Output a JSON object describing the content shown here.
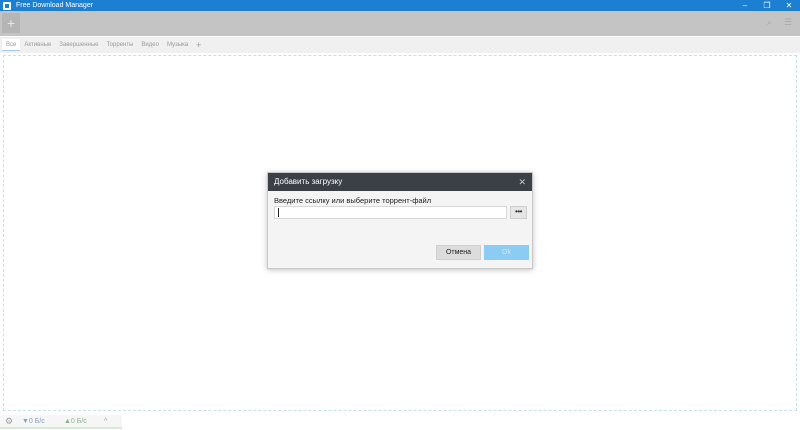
{
  "window": {
    "title": "Free Download Manager",
    "minimize_icon": "minimize-icon",
    "restore_icon": "restore-icon",
    "close_icon": "close-icon"
  },
  "toolbar": {
    "add_label": "+",
    "search_icon": "search-icon",
    "menu_icon": "menu-icon"
  },
  "tabs": [
    {
      "label": "Все",
      "active": true
    },
    {
      "label": "Активные",
      "active": false
    },
    {
      "label": "Завершенные",
      "active": false
    },
    {
      "label": "Торренты",
      "active": false
    },
    {
      "label": "Видео",
      "active": false
    },
    {
      "label": "Музыка",
      "active": false
    }
  ],
  "tab_add_label": "+",
  "statusbar": {
    "download_speed": "▼0 Б/с",
    "upload_speed": "▲0 Б/с",
    "chevron": "^"
  },
  "dialog": {
    "title": "Добавить загрузку",
    "close_label": "✕",
    "prompt": "Введите ссылку или выберите торрент-файл",
    "url_value": "",
    "browse_label": "•••",
    "cancel_label": "Отмена",
    "ok_label": "Ok"
  },
  "colors": {
    "titlebar": "#1d7fd2",
    "dialog_header": "#3b4047",
    "ok_button": "#8ccbf2"
  }
}
